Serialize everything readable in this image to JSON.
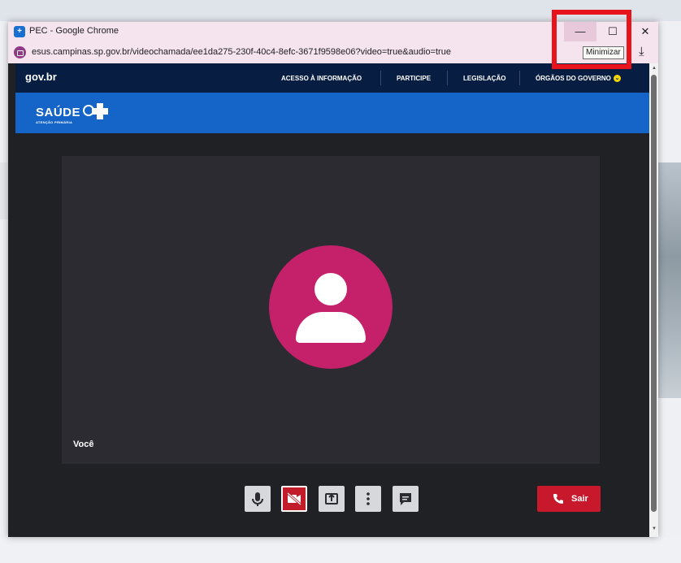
{
  "browser": {
    "title": "PEC - Google Chrome",
    "url": "esus.campinas.sp.gov.br/videochamada/ee1da275-230f-40c4-8efc-3671f9598e06?video=true&audio=true",
    "tooltip": "Minimizar",
    "icons": {
      "minimize": "minimize-icon",
      "maximize": "maximize-icon",
      "close": "close-icon",
      "download": "download-icon"
    }
  },
  "govbar": {
    "logo": "gov.br",
    "links": [
      "ACESSO À INFORMAÇÃO",
      "PARTICIPE",
      "LEGISLAÇÃO",
      "ÓRGÃOS DO GOVERNO"
    ]
  },
  "saude": {
    "logo": "SAÚDE",
    "subtitle": "ATENÇÃO PRIMÁRIA",
    "badge": "SUS"
  },
  "video": {
    "participant_label": "Você",
    "avatar_color": "#c5216a"
  },
  "controls": {
    "items": [
      "microphone-icon",
      "camera-off-icon",
      "share-screen-icon",
      "more-options-icon",
      "chat-icon"
    ],
    "leave_label": "Sair",
    "leave_color": "#c8182b"
  },
  "colors": {
    "gov_bar": "#071d41",
    "saude_bar": "#1565c8",
    "highlight": "#e8141b"
  }
}
